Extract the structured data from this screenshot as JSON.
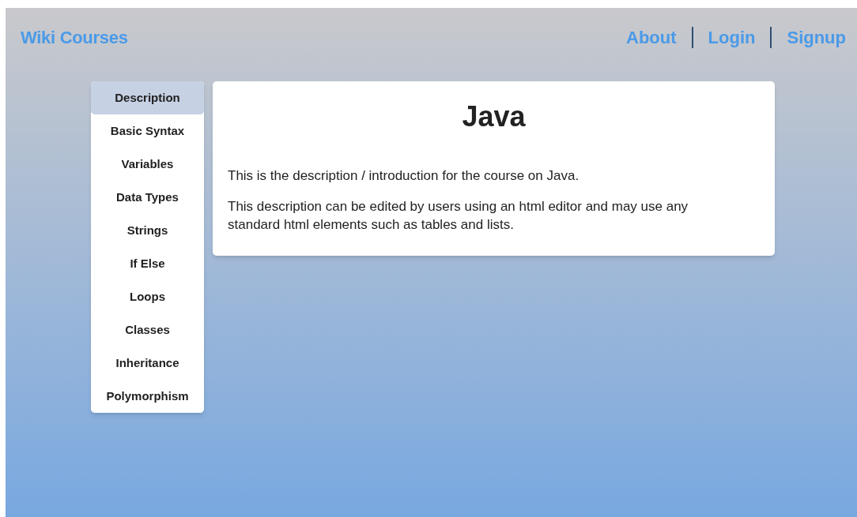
{
  "header": {
    "brand": "Wiki Courses",
    "links": [
      {
        "label": "About"
      },
      {
        "label": "Login"
      },
      {
        "label": "Signup"
      }
    ]
  },
  "sidebar": {
    "items": [
      {
        "label": "Description",
        "selected": true
      },
      {
        "label": "Basic Syntax",
        "selected": false
      },
      {
        "label": "Variables",
        "selected": false
      },
      {
        "label": "Data Types",
        "selected": false
      },
      {
        "label": "Strings",
        "selected": false
      },
      {
        "label": "If Else",
        "selected": false
      },
      {
        "label": "Loops",
        "selected": false
      },
      {
        "label": "Classes",
        "selected": false
      },
      {
        "label": "Inheritance",
        "selected": false
      },
      {
        "label": "Polymorphism",
        "selected": false
      }
    ]
  },
  "content": {
    "title": "Java",
    "paragraphs": [
      "This is the description / introduction for the course on Java.",
      "This description can be edited by users using an html editor and may use any standard html elements such as tables and lists."
    ]
  }
}
